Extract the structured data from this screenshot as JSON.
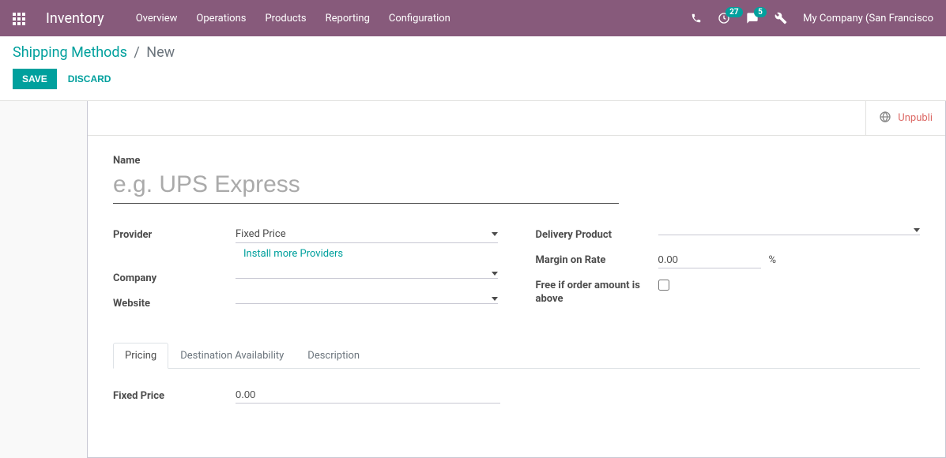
{
  "nav": {
    "app_title": "Inventory",
    "menu": [
      "Overview",
      "Operations",
      "Products",
      "Reporting",
      "Configuration"
    ],
    "activities_count": "27",
    "messages_count": "5",
    "company": "My Company (San Francisco"
  },
  "breadcrumb": {
    "parent": "Shipping Methods",
    "current": "New"
  },
  "buttons": {
    "save": "Save",
    "discard": "Discard"
  },
  "statusbar": {
    "unpublished": "Unpubli"
  },
  "form": {
    "name_label": "Name",
    "name_placeholder": "e.g. UPS Express",
    "name_value": "",
    "provider_label": "Provider",
    "provider_value": "Fixed Price",
    "install_providers": "Install more Providers",
    "company_label": "Company",
    "company_value": "",
    "website_label": "Website",
    "website_value": "",
    "delivery_product_label": "Delivery Product",
    "delivery_product_value": "",
    "margin_label": "Margin on Rate",
    "margin_value": "0.00",
    "margin_unit": "%",
    "free_over_label": "Free if order amount is above",
    "free_over_checked": false
  },
  "tabs": {
    "pricing": "Pricing",
    "destination": "Destination Availability",
    "description": "Description"
  },
  "pricing": {
    "fixed_price_label": "Fixed Price",
    "fixed_price_value": "0.00"
  }
}
